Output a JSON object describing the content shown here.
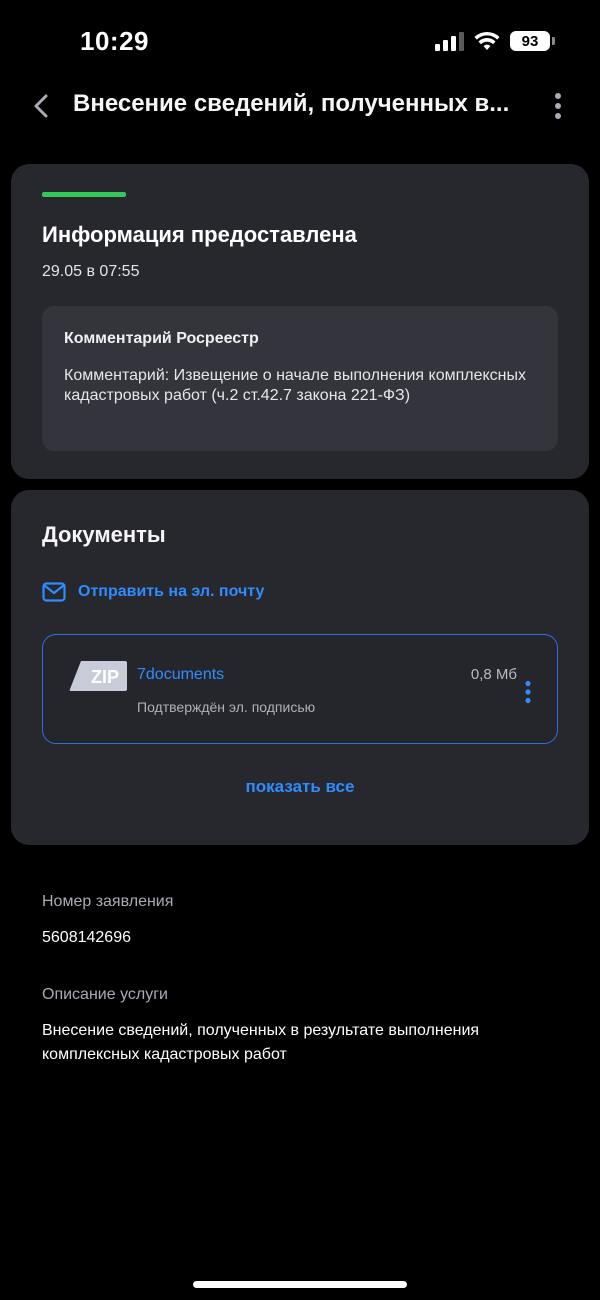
{
  "status_bar": {
    "time": "10:29",
    "battery": "93",
    "icons": [
      "signal-icon",
      "wifi-icon",
      "battery-icon"
    ]
  },
  "header": {
    "title": "Внесение сведений, полученных в...",
    "back_icon": "chevron-left-icon",
    "more_icon": "more-vertical-icon"
  },
  "status_card": {
    "progress_color": "#34c759",
    "title": "Информация предоставлена",
    "date": "29.05 в 07:55",
    "comment": {
      "title": "Комментарий Росреестр",
      "text": "Комментарий: Извещение о начале выполнения комплексных кадастровых работ (ч.2 ст.42.7  закона 221-ФЗ)"
    }
  },
  "documents_card": {
    "title": "Документы",
    "email_link": "Отправить на эл. почту",
    "email_icon": "mail-icon",
    "file": {
      "type_badge": "ZIP",
      "name": "7documents",
      "size": "0,8 Мб",
      "status": "Подтверждён эл. подписью"
    },
    "show_all": "показать все"
  },
  "info": {
    "number_label": "Номер заявления",
    "number_value": "5608142696",
    "description_label": "Описание услуги",
    "description_value": "Внесение сведений, полученных в результате выполнения комплексных кадастровых работ"
  },
  "colors": {
    "background": "#000000",
    "card": "#27282e",
    "accent": "#2f8cff",
    "success": "#34c759"
  }
}
